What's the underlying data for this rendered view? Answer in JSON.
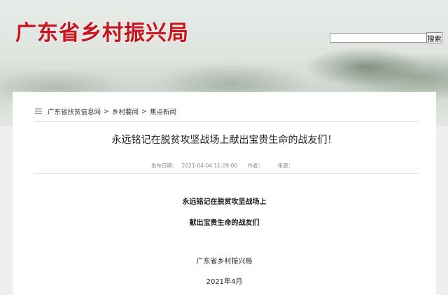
{
  "header": {
    "site_title": "广东省乡村振兴局",
    "search": {
      "value": "",
      "button_label": "搜索"
    }
  },
  "breadcrumb": {
    "items": [
      "广东省扶贫信息网",
      "乡村要闻",
      "焦点新闻"
    ],
    "separator": ">"
  },
  "article": {
    "title": "永远铭记在脱贫攻坚战场上献出宝贵生命的战友们！",
    "publish_label": "发布日期：",
    "publish_date": "2021-04-04 11:09:00",
    "author_label": "作者：",
    "author": "",
    "source_label": "来源：",
    "source": "",
    "body": [
      "永远铭记在脱贫攻坚战场上",
      "献出宝贵生命的战友们",
      "广东省乡村振兴局",
      "2021年4月"
    ]
  },
  "colors": {
    "brand_red": "#c8141e",
    "page_bg": "#eef0ee",
    "card_bg": "#ffffff"
  },
  "icons": {
    "breadcrumb": "menu-icon"
  }
}
